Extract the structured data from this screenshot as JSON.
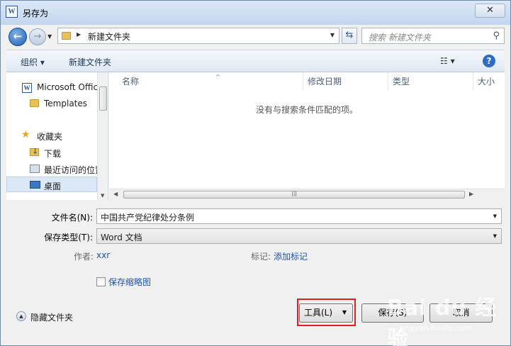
{
  "window": {
    "title": "另存为",
    "app_icon_letter": "W",
    "close_glyph": "✕"
  },
  "address": {
    "path": "新建文件夹",
    "search_placeholder": "搜索 新建文件夹"
  },
  "toolbar": {
    "organize_label": "组织 ▾",
    "new_folder_label": "新建文件夹",
    "view_glyph": "☷  ▾",
    "help_glyph": "?"
  },
  "nav": {
    "items": [
      {
        "label": "Microsoft Office",
        "icon": "word-icon"
      },
      {
        "label": "Templates",
        "icon": "folder-icon"
      },
      {
        "label": "收藏夹",
        "icon": "star-icon"
      },
      {
        "label": "下载",
        "icon": "download-folder-icon"
      },
      {
        "label": "最近访问的位置",
        "icon": "recent-places-icon"
      },
      {
        "label": "桌面",
        "icon": "desktop-icon"
      }
    ]
  },
  "filelist": {
    "columns": [
      "名称",
      "修改日期",
      "类型",
      "大小"
    ],
    "empty_message": "没有与搜索条件匹配的项。"
  },
  "form": {
    "filename_label": "文件名(N):",
    "filename_value": "中国共产党纪律处分条例",
    "filetype_label": "保存类型(T):",
    "filetype_value": "Word 文档",
    "author_label": "作者:",
    "author_value": "xxr",
    "tags_label": "标记:",
    "tags_link": "添加标记",
    "thumbnail_label": "保存缩略图"
  },
  "footer": {
    "hide_folders_label": "隐藏文件夹",
    "tools_label": "工具(L)",
    "save_label": "保存(S)",
    "cancel_label": "取消"
  },
  "watermark": {
    "logo": "Bai du 经验",
    "url": "jingyan.baidu.com"
  },
  "colors": {
    "highlight_box": "#e02020",
    "link": "#1e56b0"
  }
}
